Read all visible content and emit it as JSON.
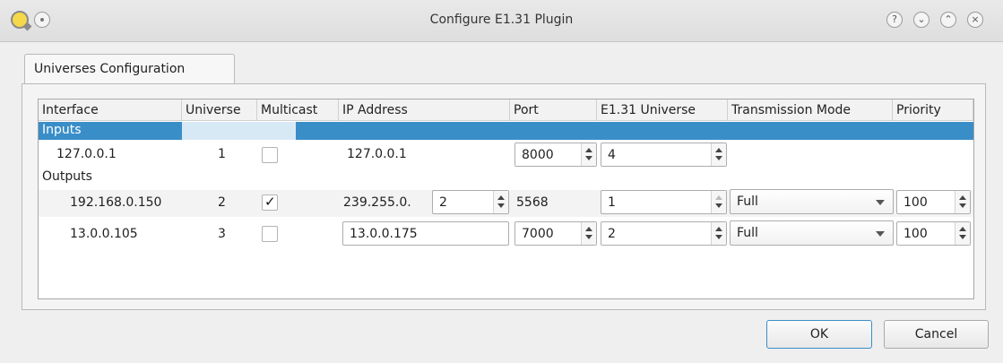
{
  "window": {
    "title": "Configure E1.31 Plugin",
    "buttons": {
      "help": "?",
      "minimize": "⌄",
      "maximize": "⌃",
      "close": "×"
    }
  },
  "tabs": [
    {
      "label": "Universes Configuration"
    }
  ],
  "table": {
    "headers": [
      "Interface",
      "Universe",
      "Multicast",
      "IP Address",
      "Port",
      "E1.31 Universe",
      "Transmission Mode",
      "Priority"
    ],
    "inputs_group": "Inputs",
    "outputs_group": "Outputs",
    "inputs": [
      {
        "interface": "127.0.0.1",
        "universe": "1",
        "multicast": false,
        "ip": "127.0.0.1",
        "port": "8000",
        "e131_universe": "4"
      }
    ],
    "outputs": [
      {
        "interface": "192.168.0.150",
        "universe": "2",
        "multicast": true,
        "ip_prefix": "239.255.0.",
        "ip_suffix": "2",
        "port": "5568",
        "e131_universe": "1",
        "mode": "Full",
        "priority": "100"
      },
      {
        "interface": "13.0.0.105",
        "universe": "3",
        "multicast": false,
        "ip": "13.0.0.175",
        "port": "7000",
        "e131_universe": "2",
        "mode": "Full",
        "priority": "100"
      }
    ]
  },
  "dialog_buttons": {
    "ok": "OK",
    "cancel": "Cancel"
  },
  "colors": {
    "selection": "#3a8ec8",
    "default_button_border": "#3a8ec8"
  }
}
